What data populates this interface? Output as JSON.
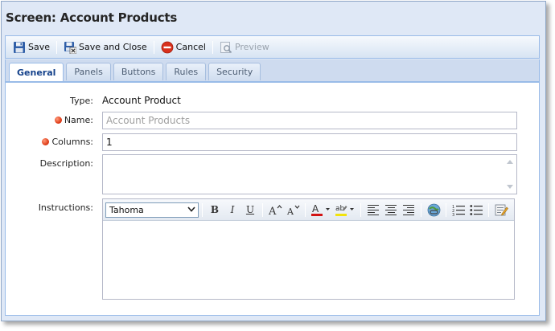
{
  "window": {
    "title": "Screen: Account Products"
  },
  "toolbar": {
    "save_label": "Save",
    "save_close_label": "Save and Close",
    "cancel_label": "Cancel",
    "preview_label": "Preview"
  },
  "tabs": [
    {
      "label": "General",
      "active": true
    },
    {
      "label": "Panels",
      "active": false
    },
    {
      "label": "Buttons",
      "active": false
    },
    {
      "label": "Rules",
      "active": false
    },
    {
      "label": "Security",
      "active": false
    }
  ],
  "form": {
    "type_label": "Type:",
    "type_value": "Account Product",
    "name_label": "Name:",
    "name_placeholder": "Account Products",
    "columns_label": "Columns:",
    "columns_value": "1",
    "description_label": "Description:",
    "instructions_label": "Instructions:"
  },
  "editor": {
    "font_value": "Tahoma",
    "bold_glyph": "B",
    "italic_glyph": "I",
    "underline_glyph": "U"
  },
  "colors": {
    "accent": "#15428b",
    "required": "#e0401c",
    "frame": "#99bbe8"
  }
}
